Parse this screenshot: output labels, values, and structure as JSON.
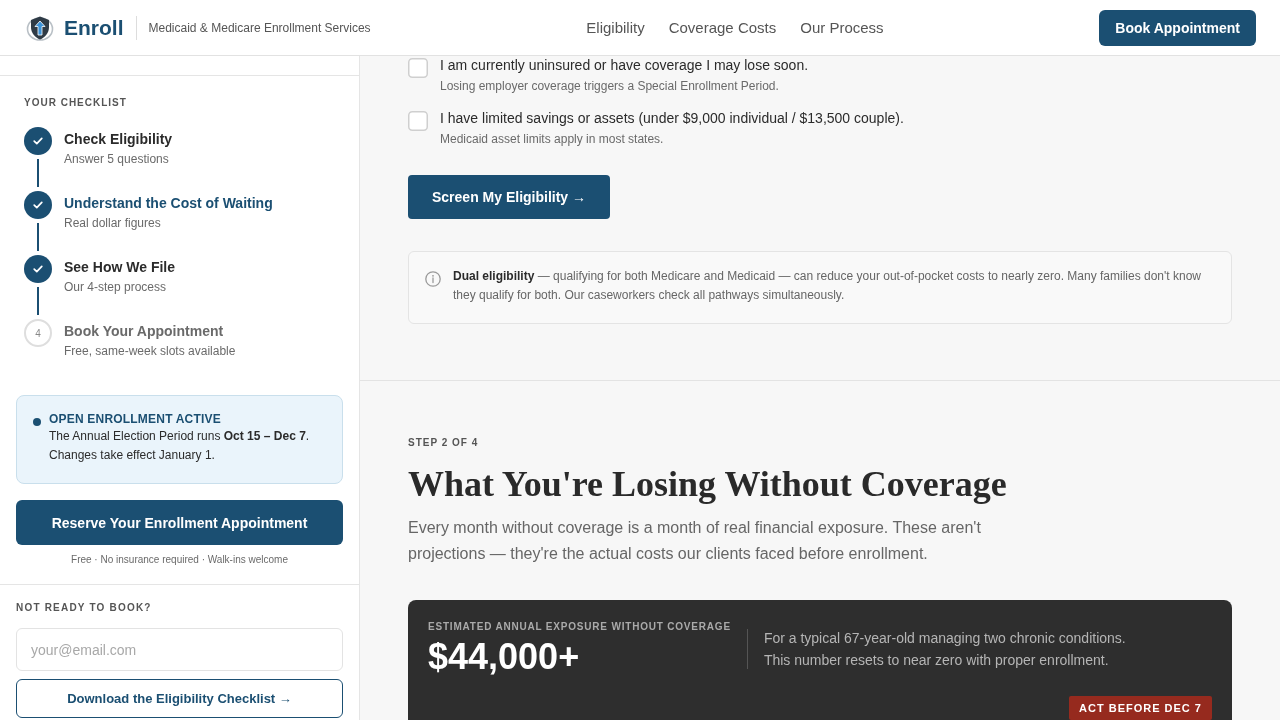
{
  "header": {
    "brand": "Enroll",
    "tagline": "Medicaid & Medicare Enrollment Services",
    "nav": [
      {
        "label": "Eligibility"
      },
      {
        "label": "Coverage Costs"
      },
      {
        "label": "Our Process"
      }
    ],
    "book_button": "Book Appointment"
  },
  "sidebar": {
    "checklist_title": "YOUR CHECKLIST",
    "steps": [
      {
        "title": "Check Eligibility",
        "subtitle": "Answer 5 questions",
        "done": true,
        "selected": false
      },
      {
        "title": "Understand the Cost of Waiting",
        "subtitle": "Real dollar figures",
        "done": true,
        "selected": true
      },
      {
        "title": "See How We File",
        "subtitle": "Our 4-step process",
        "done": true,
        "selected": false
      },
      {
        "number": "4",
        "title": "Book Your Appointment",
        "subtitle": "Free, same-week slots available",
        "done": false,
        "selected": false
      }
    ],
    "notice": {
      "title": "OPEN ENROLLMENT ACTIVE",
      "text": "The Annual Election Period runs **Oct 15 – Dec 7**. Changes take effect January 1."
    },
    "reserve_button": "Reserve Your Enrollment Appointment",
    "reserve_note": "Free · No insurance required · Walk-ins welcome",
    "lead_capture": {
      "title": "NOT READY TO BOOK?",
      "email_field": {
        "placeholder": "your@email.com"
      },
      "download_button": "Download the Eligibility Checklist →"
    }
  },
  "main": {
    "questions": [
      {
        "question": "I am currently uninsured or have coverage I may lose soon.",
        "hint": "Losing employer coverage triggers a Special Enrollment Period.",
        "checked": false
      },
      {
        "question": "I have limited savings or assets (under $9,000 individual / $13,500 couple).",
        "hint": "Medicaid asset limits apply in most states.",
        "checked": false
      }
    ],
    "screen_button": "Screen My Eligibility →",
    "info_note": "**Dual eligibility** — qualifying for both Medicare and Medicaid — can reduce your out-of-pocket costs to nearly zero. Many families don't know they qualify for both. Our caseworkers check all pathways simultaneously.",
    "section": {
      "step_label": "STEP 2 OF 4",
      "title": "What You're Losing Without Coverage",
      "intro": "Every month without coverage is a month of real financial exposure. These aren't projections — they're the actual costs our clients faced before enrollment.",
      "exposure_card": {
        "label": "ESTIMATED ANNUAL EXPOSURE WITHOUT COVERAGE",
        "amount": "$44,000+",
        "description": "For a typical 67-year-old managing two chronic conditions. This number resets to near zero with proper enrollment.",
        "badge": "ACT BEFORE DEC 7"
      }
    }
  }
}
